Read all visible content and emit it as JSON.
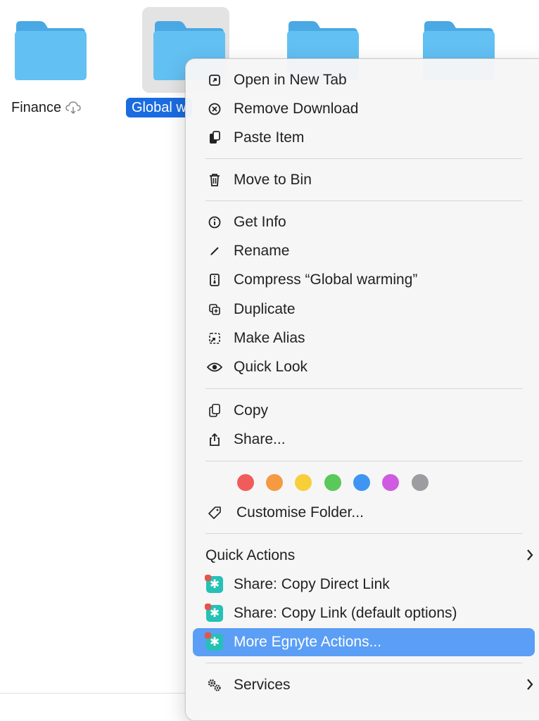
{
  "folders": [
    {
      "name": "Finance",
      "selected": false,
      "cloud": true
    },
    {
      "name": "Global w",
      "selected": true,
      "cloud": false
    },
    {
      "name": "",
      "selected": false,
      "cloud": false
    },
    {
      "name": "",
      "selected": false,
      "cloud": false
    }
  ],
  "menu": {
    "group1": [
      {
        "label": "Open in New Tab",
        "icon": "open-in-tab-icon"
      },
      {
        "label": "Remove Download",
        "icon": "remove-download-icon"
      },
      {
        "label": "Paste Item",
        "icon": "paste-icon"
      }
    ],
    "group2": [
      {
        "label": "Move to Bin",
        "icon": "trash-icon"
      }
    ],
    "group3": [
      {
        "label": "Get Info",
        "icon": "info-icon"
      },
      {
        "label": "Rename",
        "icon": "pencil-icon"
      },
      {
        "label": "Compress “Global warming”",
        "icon": "archive-icon"
      },
      {
        "label": "Duplicate",
        "icon": "duplicate-icon"
      },
      {
        "label": "Make Alias",
        "icon": "alias-icon"
      },
      {
        "label": "Quick Look",
        "icon": "eye-icon"
      }
    ],
    "group4": [
      {
        "label": "Copy",
        "icon": "copy-icon"
      },
      {
        "label": "Share...",
        "icon": "share-icon"
      }
    ],
    "tags": [
      "#f25b5b",
      "#f59a42",
      "#f7cf3b",
      "#5ac85a",
      "#3f96f2",
      "#cf5ce0",
      "#9d9da1"
    ],
    "customise": {
      "label": "Customise Folder...",
      "icon": "tag-icon"
    },
    "quick_actions": {
      "label": "Quick Actions"
    },
    "group6": [
      {
        "label": "Share: Copy Direct Link",
        "icon": "egnyte-icon"
      },
      {
        "label": "Share: Copy Link (default options)",
        "icon": "egnyte-icon"
      },
      {
        "label": "More Egnyte Actions...",
        "icon": "egnyte-icon",
        "highlighted": true
      }
    ],
    "services": {
      "label": "Services",
      "icon": "gears-icon"
    }
  },
  "colors": {
    "highlight": "#5b9ef5",
    "selection": "#1a6ce0",
    "folder": "#5ab8ee"
  }
}
